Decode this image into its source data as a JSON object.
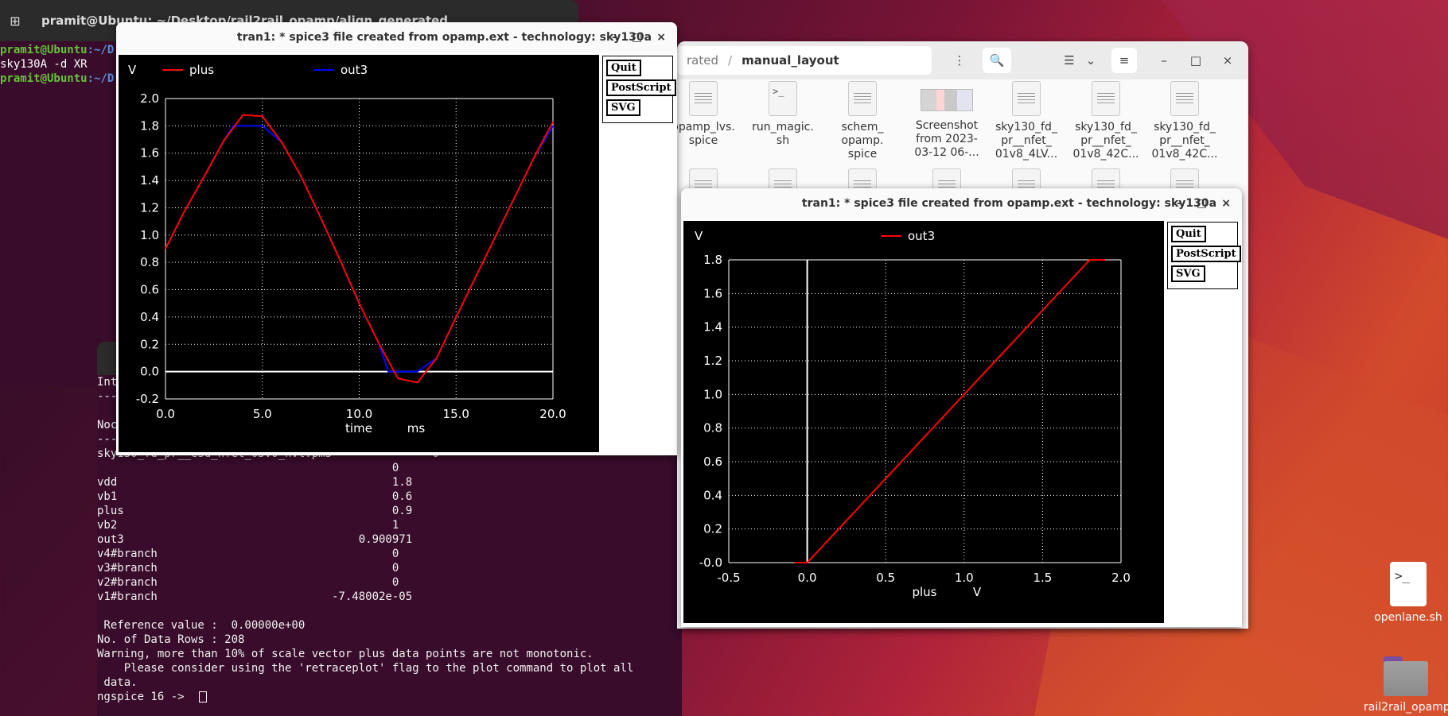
{
  "terminal_main": {
    "title": "pramit@Ubuntu: ~/Desktop/rail2rail_opamp/align_generated",
    "lines": [
      {
        "user": "pramit@Ubuntu",
        "path": ":~/D"
      },
      {
        "text": "sky130A -d XR"
      },
      {
        "user": "pramit@Ubuntu",
        "path": ":~/D"
      }
    ]
  },
  "terminal_ngspice": {
    "lines": [
      "Int",
      "---",
      "",
      "Noc",
      "----                                         -------",
      "sky130_fd_pr__esd_nfet_05v0_nvt.pm3               0",
      "                                            0",
      "vdd                                         1.8",
      "vb1                                         0.6",
      "plus                                        0.9",
      "vb2                                         1",
      "out3                                   0.900971",
      "v4#branch                                   0",
      "v3#branch                                   0",
      "v2#branch                                   0",
      "v1#branch                          -7.48002e-05",
      "",
      " Reference value :  0.00000e+00",
      "No. of Data Rows : 208",
      "Warning, more than 10% of scale vector plus data points are not monotonic.",
      "    Please consider using the 'retraceplot' flag to the plot command to plot all",
      " data.",
      "ngspice 16 -> "
    ]
  },
  "file_manager": {
    "breadcrumb_prev": "rated",
    "breadcrumb_sep": "/",
    "breadcrumb_current": "manual_layout",
    "files": [
      {
        "name": "opamp_lvs.\nspice",
        "kind": "doc"
      },
      {
        "name": "run_magic.\nsh",
        "kind": "sh"
      },
      {
        "name": "schem_\nopamp.\nspice",
        "kind": "doc"
      },
      {
        "name": "Screenshot\nfrom 2023-\n03-12 06-...",
        "kind": "img"
      },
      {
        "name": "sky130_fd_\npr__nfet_\n01v8_4LV...",
        "kind": "doc"
      },
      {
        "name": "sky130_fd_\npr__nfet_\n01v8_42C...",
        "kind": "doc"
      },
      {
        "name": "sky130_fd_\npr__nfet_\n01v8_42C...",
        "kind": "doc"
      }
    ]
  },
  "plot1": {
    "title": "tran1: * spice3 file created from opamp.ext - technology: sky130a",
    "buttons": [
      "Quit",
      "PostScript",
      "SVG"
    ]
  },
  "plot2": {
    "title": "tran1: * spice3 file created from opamp.ext - technology: sky130a",
    "buttons": [
      "Quit",
      "PostScript",
      "SVG"
    ]
  },
  "window_controls": {
    "minimize": "–",
    "maximize": "□",
    "close": "×"
  },
  "desktop_icons": [
    {
      "label": "openlane.sh",
      "kind": "sh"
    },
    {
      "label": "rail2rail_opamp",
      "kind": "folder"
    }
  ],
  "chart_data": [
    {
      "type": "line",
      "ylabel": "V",
      "xlabel": "time",
      "xunit": "ms",
      "xlim": [
        0,
        20
      ],
      "ylim": [
        -0.2,
        2.0
      ],
      "xticks": [
        "0.0",
        "5.0",
        "10.0",
        "15.0",
        "20.0"
      ],
      "yticks": [
        "-0.2",
        "0.0",
        "0.2",
        "0.4",
        "0.6",
        "0.8",
        "1.0",
        "1.2",
        "1.4",
        "1.6",
        "1.8",
        "2.0"
      ],
      "grid": true,
      "legend_position": "top",
      "series": [
        {
          "name": "plus",
          "color": "#ff0000",
          "x": [
            0,
            1,
            2,
            3,
            4,
            5,
            6,
            7,
            8,
            9,
            10,
            11,
            12,
            13,
            14,
            15,
            16,
            17,
            18,
            19,
            20
          ],
          "y": [
            0.9,
            1.18,
            1.43,
            1.69,
            1.88,
            1.87,
            1.68,
            1.43,
            1.13,
            0.82,
            0.5,
            0.21,
            -0.05,
            -0.08,
            0.1,
            0.4,
            0.69,
            0.98,
            1.27,
            1.56,
            1.83
          ]
        },
        {
          "name": "out3",
          "color": "#0000ff",
          "x": [
            0,
            1,
            2,
            3,
            3.5,
            4,
            5,
            6,
            7,
            8,
            9,
            10,
            11,
            11.5,
            12,
            13,
            14,
            15,
            16,
            17,
            18,
            19,
            20
          ],
          "y": [
            0.9,
            1.18,
            1.43,
            1.69,
            1.8,
            1.8,
            1.8,
            1.68,
            1.43,
            1.13,
            0.82,
            0.5,
            0.21,
            0.0,
            0.0,
            0.0,
            0.1,
            0.4,
            0.69,
            0.98,
            1.27,
            1.56,
            1.8
          ]
        }
      ]
    },
    {
      "type": "line",
      "ylabel": "V",
      "xlabel": "plus",
      "xunit": "V",
      "xlim": [
        -0.5,
        2.0
      ],
      "ylim": [
        0.0,
        1.8
      ],
      "xticks": [
        "-0.5",
        "0.0",
        "0.5",
        "1.0",
        "1.5",
        "2.0"
      ],
      "yticks": [
        "-0.0",
        "0.2",
        "0.4",
        "0.6",
        "0.8",
        "1.0",
        "1.2",
        "1.4",
        "1.6",
        "1.8"
      ],
      "grid": true,
      "legend_position": "top",
      "series": [
        {
          "name": "out3",
          "color": "#ff0000",
          "x": [
            -0.08,
            0.0,
            0.5,
            1.0,
            1.5,
            1.8,
            1.9
          ],
          "y": [
            0.0,
            0.0,
            0.5,
            1.0,
            1.5,
            1.8,
            1.8
          ]
        }
      ]
    }
  ]
}
